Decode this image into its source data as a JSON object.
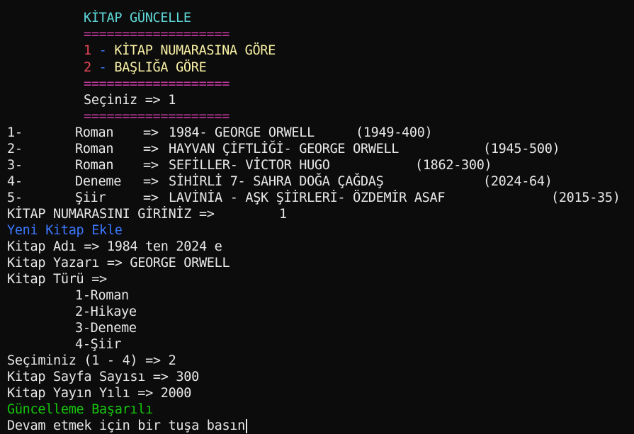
{
  "menu": {
    "title": "KİTAP GÜNCELLE",
    "separator": "===================",
    "options": [
      {
        "num": "1",
        "dash": " - ",
        "label": "KİTAP NUMARASINA GÖRE"
      },
      {
        "num": "2",
        "dash": " - ",
        "label": "BAŞLIĞA GÖRE"
      }
    ],
    "choice_prompt": "Seçiniz => 1"
  },
  "book_list": [
    {
      "num": "1-",
      "type": "Roman",
      "arrow": "=>",
      "title": "1984- GEORGE ORWELL",
      "meta": "(1949-400)"
    },
    {
      "num": "2-",
      "type": "Roman",
      "arrow": "=>",
      "title": "HAYVAN ÇİFTLİĞİ- GEORGE ORWELL",
      "meta": "(1945-500)"
    },
    {
      "num": "3-",
      "type": "Roman",
      "arrow": "=>",
      "title": "SEFİLLER- VİCTOR HUGO",
      "meta": "(1862-300)"
    },
    {
      "num": "4-",
      "type": "Deneme",
      "arrow": "=>",
      "title": "SİHİRLİ 7- SAHRA DOĞA ÇAĞDAŞ",
      "meta": "(2024-64)"
    },
    {
      "num": "5-",
      "type": "Şiir",
      "arrow": "=>",
      "title": "LAVİNİA - AŞK ŞİİRLERİ- ÖZDEMİR ASAF",
      "meta": "(2015-35)"
    }
  ],
  "number_prompt": "KİTAP NUMARASINI GİRİNİZ =>",
  "number_value": "1",
  "new_book_header": "Yeni Kitap Ekle",
  "fields": {
    "name": "Kitap Adı => 1984 ten 2024 e",
    "author": "Kitap Yazarı => GEORGE ORWELL",
    "type": "Kitap Türü =>"
  },
  "type_options": [
    "1-Roman",
    "2-Hikaye",
    "3-Deneme",
    "4-Şiir"
  ],
  "selection": "Seçiminiz (1 - 4) => 2",
  "pages": "Kitap Sayfa Sayısı => 300",
  "year": "Kitap Yayın Yılı => 2000",
  "success": "Güncelleme Başarılı",
  "continue_prompt": "Devam etmek için bir tuşa basın",
  "colors": {
    "background": "#0c0c0c",
    "cyan": "#5fd7d7",
    "magenta": "#c53aa0",
    "red": "#e74856",
    "blue": "#3b78ff",
    "yellow": "#f9f1a5",
    "green": "#16c60c"
  }
}
